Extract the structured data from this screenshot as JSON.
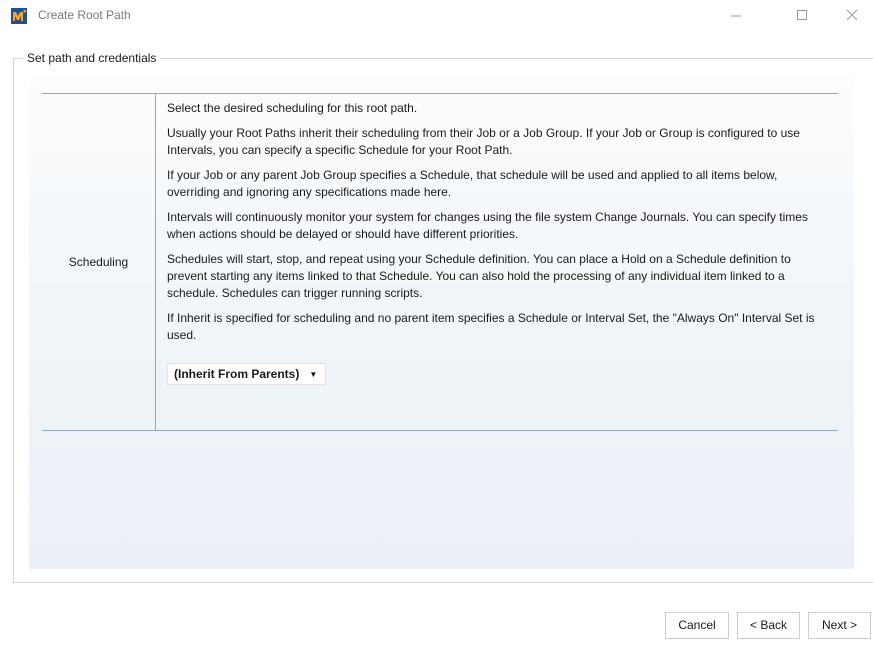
{
  "window": {
    "title": "Create Root Path",
    "icon": "app-logo-icon",
    "controls": {
      "minimize": "minimize-icon",
      "maximize": "maximize-icon",
      "close": "close-icon"
    }
  },
  "group": {
    "legend": "Set path and credentials"
  },
  "scheduling": {
    "label": "Scheduling",
    "paragraphs": [
      "Select the desired scheduling for this root path.",
      "Usually your Root Paths inherit their scheduling from their Job or a Job Group. If your Job or Group is configured to use Intervals, you can specify a specific Schedule for your Root Path.",
      "If your Job or any parent Job Group specifies a Schedule, that schedule will be used and applied to all items below, overriding and ignoring any specifications made here.",
      "Intervals will continuously monitor your system for changes using the file system Change Journals. You can specify times when actions should be delayed or should have different priorities.",
      "Schedules will start, stop, and repeat using your Schedule definition. You can place a Hold on a Schedule definition to prevent starting any items linked to that Schedule. You can also hold the processing of any individual item linked to a schedule. Schedules can trigger running scripts.",
      "If Inherit is specified for scheduling and no parent item specifies a Schedule or Interval Set, the \"Always On\" Interval Set is used."
    ],
    "dropdown": {
      "selected": "(Inherit From Parents)"
    }
  },
  "buttons": {
    "cancel": "Cancel",
    "back": "< Back",
    "next": "Next >"
  },
  "colors": {
    "table_border": "#8ea9c9",
    "panel_bg": "#eaf0f6",
    "logo_blue": "#1f4e9c",
    "logo_orange": "#f5a623"
  }
}
